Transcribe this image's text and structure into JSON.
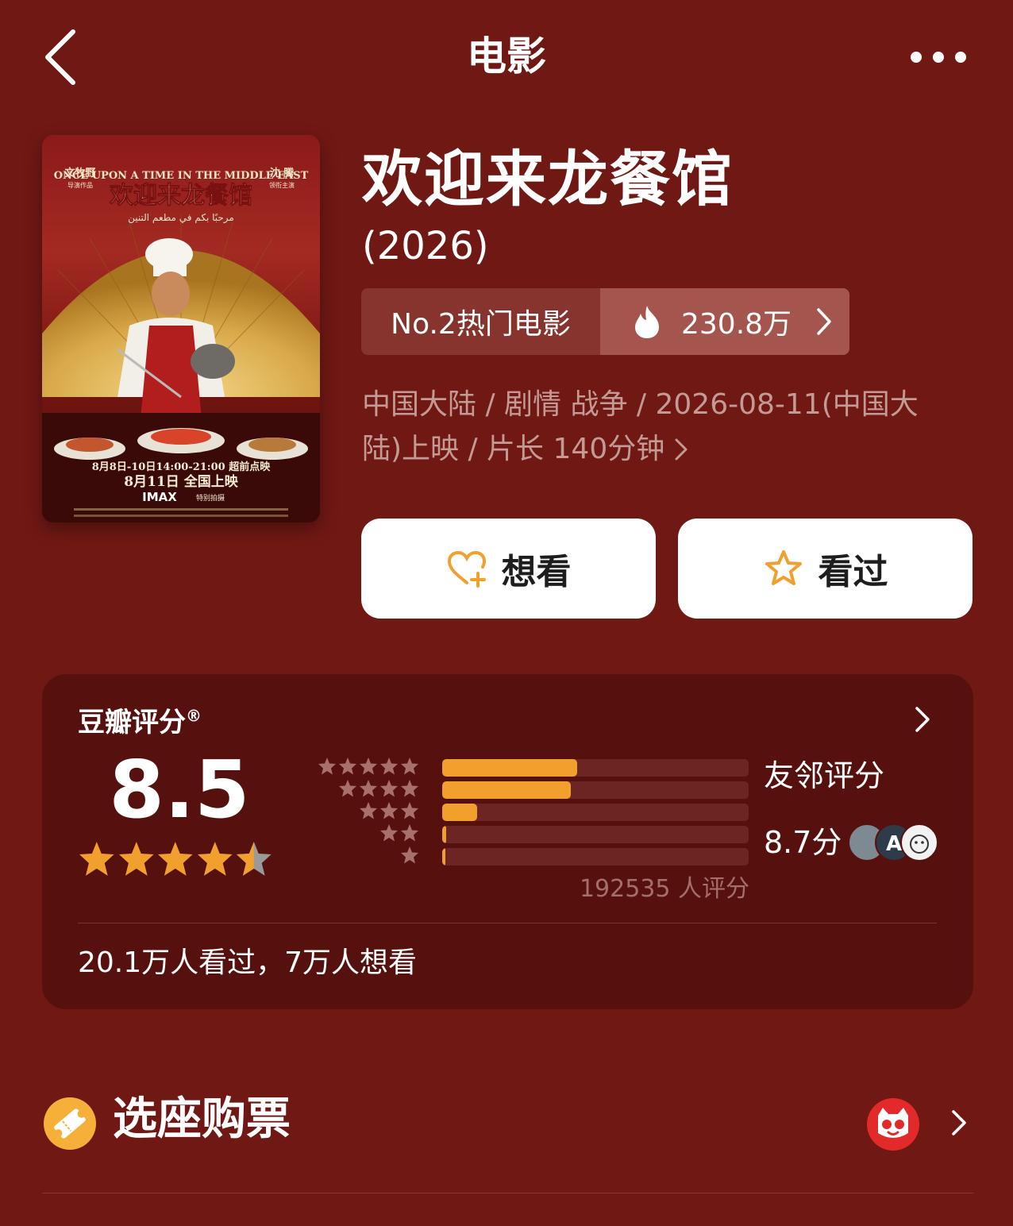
{
  "header": {
    "title": "电影"
  },
  "poster": {
    "top_text": "ONCE UPON A TIME IN THE MIDDLE EAST",
    "cn_title": "欢迎来龙餐馆",
    "arabic_title": "مرحبًا بكم في مطعم التنين",
    "left_credit": "文牧野",
    "left_credit_sub": "导演作品",
    "right_credit": "沈 腾",
    "right_credit_sub": "领衔主演",
    "presale": "8月8日-10日14:00-21:00 超前点映",
    "release": "8月11日 全国上映",
    "imax": "IMAX",
    "imax_note": "特别拍摄"
  },
  "movie": {
    "title": "欢迎来龙餐馆",
    "year": "(2026)",
    "rank_label": "No.2热门电影",
    "heat": "230.8万",
    "meta": "中国大陆 / 剧情 战争 / 2026-08-11(中国大陆)上映 / 片长 140分钟"
  },
  "actions": {
    "want": "想看",
    "seen": "看过"
  },
  "rating": {
    "header": "豆瓣评分",
    "registered": "®",
    "score": "8.5",
    "score_stars": 4.5,
    "distribution": [
      {
        "stars": 5,
        "fraction": 0.44
      },
      {
        "stars": 4,
        "fraction": 0.42
      },
      {
        "stars": 3,
        "fraction": 0.115
      },
      {
        "stars": 2,
        "fraction": 0.012
      },
      {
        "stars": 1,
        "fraction": 0.008
      }
    ],
    "total": "192535 人评分",
    "friends_label": "友邻评分",
    "friends_score": "8.7分",
    "watch_stats": "20.1万人看过，7万人想看"
  },
  "tickets": {
    "label": "选座购票"
  },
  "colors": {
    "background": "#701814",
    "card": "#56110f",
    "accent": "#f2a02d",
    "rank_left": "#87332e",
    "rank_right": "#a4554e",
    "meta_text": "#c49a95"
  },
  "icons": {
    "back": "chevron-left-icon",
    "more": "more-dots-icon",
    "heat": "fire-icon",
    "want": "heart-plus-icon",
    "seen": "star-outline-icon",
    "ticket": "ticket-icon",
    "maoyan": "cat-logo-icon"
  }
}
